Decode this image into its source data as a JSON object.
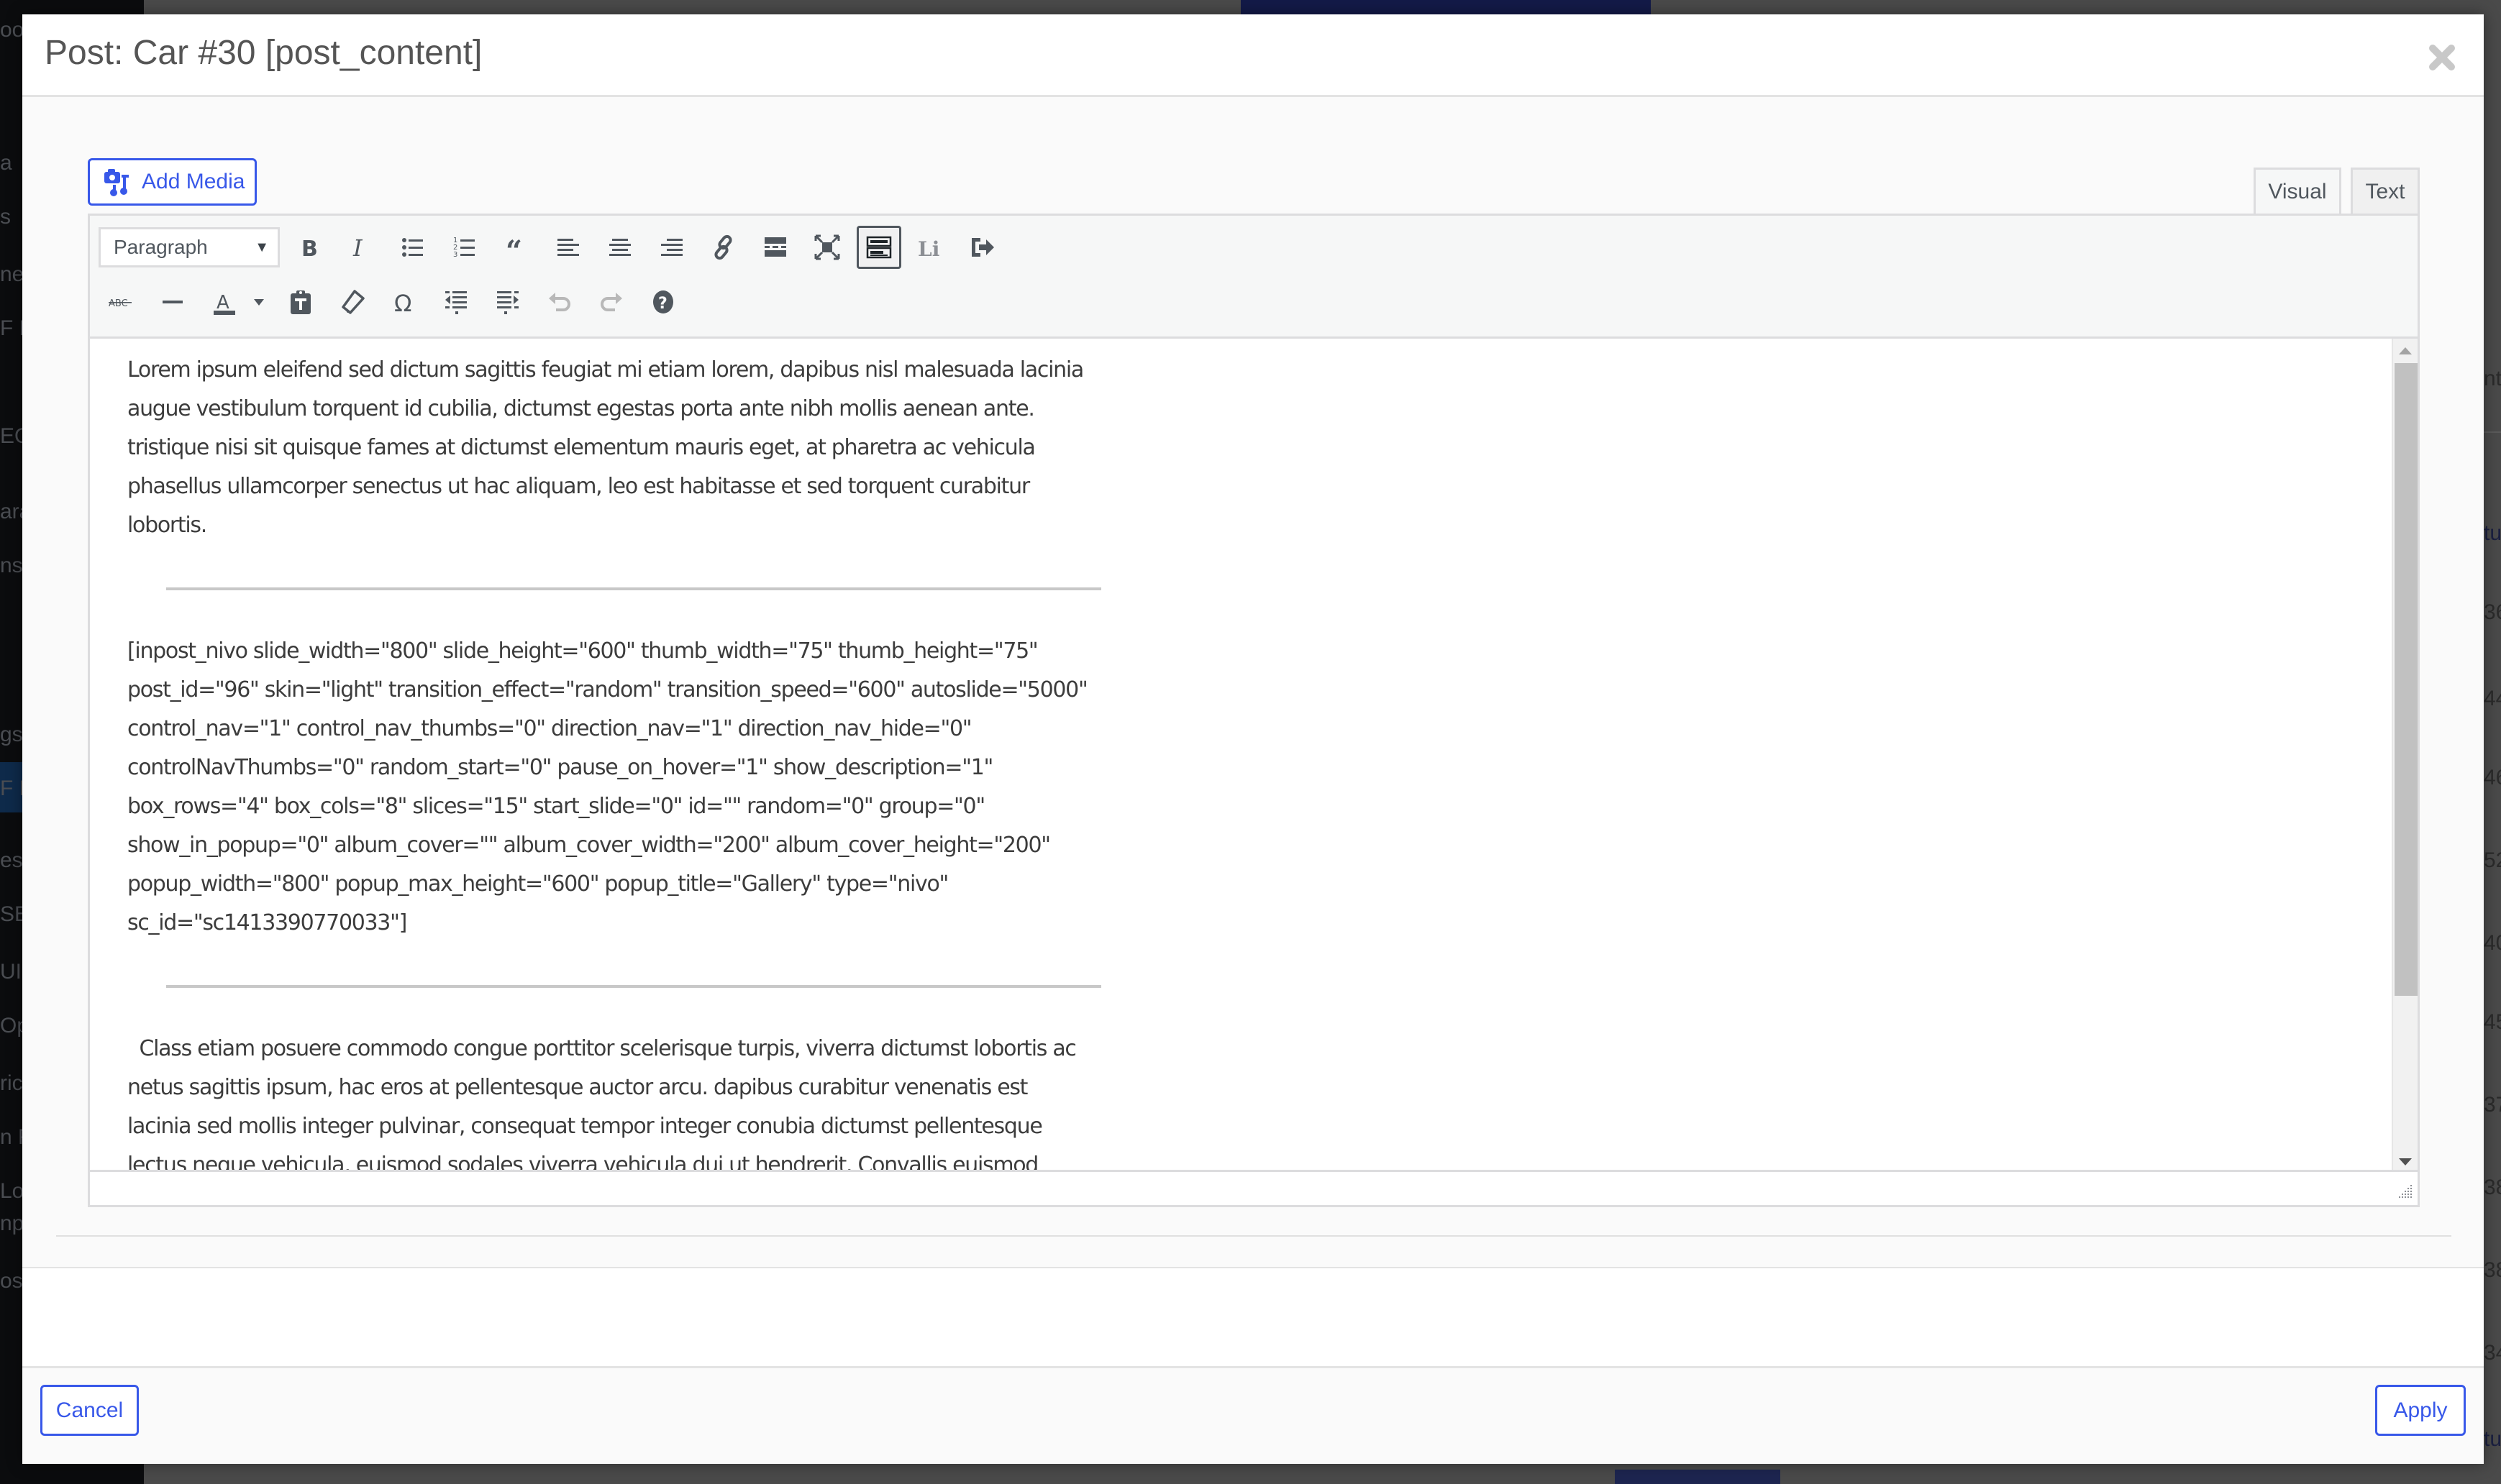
{
  "modal": {
    "title": "Post: Car #30 [post_content]",
    "close_icon": "close-x-icon"
  },
  "toolbar": {
    "add_media_label": "Add Media",
    "add_media_icon": "camera-music-icon",
    "tabs": [
      {
        "label": "Visual",
        "active": true
      },
      {
        "label": "Text",
        "active": false
      }
    ],
    "format_select": "Paragraph",
    "row1_buttons": [
      {
        "name": "bold",
        "icon": "bold-icon"
      },
      {
        "name": "italic",
        "icon": "italic-icon"
      },
      {
        "name": "bullet-list",
        "icon": "bullet-list-icon"
      },
      {
        "name": "numbered-list",
        "icon": "numbered-list-icon"
      },
      {
        "name": "blockquote",
        "icon": "quote-icon"
      },
      {
        "name": "align-left",
        "icon": "align-left-icon"
      },
      {
        "name": "align-center",
        "icon": "align-center-icon"
      },
      {
        "name": "align-right",
        "icon": "align-right-icon"
      },
      {
        "name": "insert-link",
        "icon": "link-icon"
      },
      {
        "name": "read-more",
        "icon": "read-more-icon"
      },
      {
        "name": "fullscreen",
        "icon": "fullscreen-icon"
      },
      {
        "name": "toolbar-toggle",
        "icon": "keyboard-icon",
        "active": true
      },
      {
        "name": "li",
        "icon": "li-icon"
      },
      {
        "name": "exit",
        "icon": "exit-arrow-icon"
      }
    ],
    "row2_buttons": [
      {
        "name": "strikethrough",
        "icon": "strikethrough-icon"
      },
      {
        "name": "horizontal-line",
        "icon": "horizontal-line-icon"
      },
      {
        "name": "text-color",
        "icon": "text-color-icon"
      },
      {
        "name": "text-color-dropdown",
        "icon": "caret-down-icon"
      },
      {
        "name": "paste-as-text",
        "icon": "paste-text-icon"
      },
      {
        "name": "clear-formatting",
        "icon": "eraser-icon"
      },
      {
        "name": "special-character",
        "icon": "omega-icon"
      },
      {
        "name": "outdent",
        "icon": "outdent-icon"
      },
      {
        "name": "indent",
        "icon": "indent-icon"
      },
      {
        "name": "undo",
        "icon": "undo-icon",
        "disabled": true
      },
      {
        "name": "redo",
        "icon": "redo-icon",
        "disabled": true
      },
      {
        "name": "help",
        "icon": "help-icon"
      }
    ]
  },
  "content": {
    "para1": [
      "Lorem ipsum eleifend sed dictum sagittis feugiat mi etiam lorem, dapibus nisl malesuada lacinia",
      "augue vestibulum torquent id cubilia, dictumst egestas porta ante nibh mollis aenean ante.",
      "tristique nisi sit quisque fames at dictumst elementum mauris eget, at pharetra ac vehicula",
      "phasellus ullamcorper senectus ut hac aliquam, leo est habitasse et sed torquent curabitur",
      "lobortis."
    ],
    "shortcode": [
      "[inpost_nivo slide_width=\"800\" slide_height=\"600\" thumb_width=\"75\" thumb_height=\"75\"",
      "post_id=\"96\" skin=\"light\" transition_effect=\"random\" transition_speed=\"600\" autoslide=\"5000\"",
      "control_nav=\"1\" control_nav_thumbs=\"0\" direction_nav=\"1\" direction_nav_hide=\"0\"",
      "controlNavThumbs=\"0\" random_start=\"0\" pause_on_hover=\"1\" show_description=\"1\"",
      "box_rows=\"4\" box_cols=\"8\" slices=\"15\" start_slide=\"0\" id=\"\" random=\"0\" group=\"0\"",
      "show_in_popup=\"0\" album_cover=\"\" album_cover_width=\"200\" album_cover_height=\"200\"",
      "popup_width=\"800\" popup_max_height=\"600\" popup_title=\"Gallery\" type=\"nivo\"",
      "sc_id=\"sc1413390770033\"]"
    ],
    "para3": [
      "  Class etiam posuere commodo congue porttitor scelerisque turpis, viverra dictumst lobortis ac",
      "netus sagittis ipsum, hac eros at pellentesque auctor arcu. dapibus curabitur venenatis est",
      "lacinia sed mollis integer pulvinar, consequat tempor integer conubia dictumst pellentesque",
      "lectus neque vehicula, euismod sodales viverra vehicula dui ut hendrerit. Convallis euismod"
    ],
    "scroll_position": 0.0
  },
  "footer": {
    "cancel_label": "Cancel",
    "apply_label": "Apply"
  },
  "background": {
    "sidebar_fragments": [
      "oo",
      "a",
      "s",
      "ne",
      "F Fi",
      "EO",
      "ara",
      "ns",
      "gs",
      "F B",
      "es",
      "SE",
      "UI",
      "Opt",
      "ric",
      "n F",
      "Lo",
      "npt",
      "ose"
    ],
    "right_fragments": [
      "nt",
      "tu",
      "36",
      "44",
      "46",
      "52",
      "40",
      "45",
      "37",
      "38",
      "38",
      "34",
      "tu"
    ]
  },
  "colors": {
    "accent": "#3858e9",
    "text": "#3c3c3c",
    "overlay": "#4a4a4a"
  }
}
